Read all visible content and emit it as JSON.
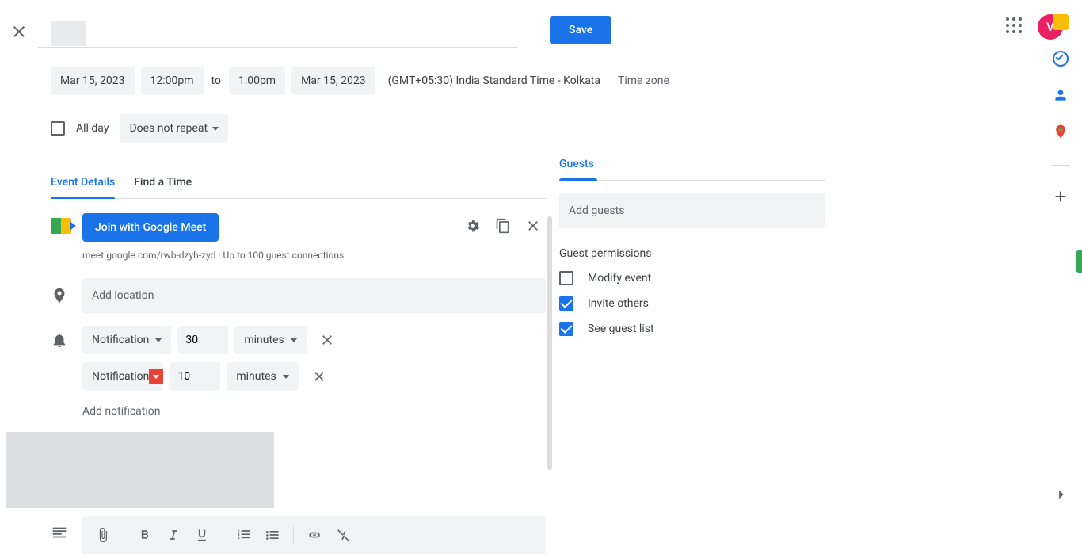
{
  "header": {
    "save_label": "Save",
    "avatar_initial": "V"
  },
  "date": {
    "start_date": "Mar 15, 2023",
    "start_time": "12:00pm",
    "to": "to",
    "end_time": "1:00pm",
    "end_date": "Mar 15, 2023",
    "timezone_text": "(GMT+05:30) India Standard Time - Kolkata",
    "timezone_btn": "Time zone"
  },
  "allday": {
    "label": "All day",
    "repeat": "Does not repeat"
  },
  "tabs": {
    "event_details": "Event Details",
    "find_time": "Find a Time"
  },
  "meet": {
    "btn": "Join with Google Meet",
    "sub": "meet.google.com/rwb-dzyh-zyd · Up to 100 guest connections"
  },
  "location": {
    "placeholder": "Add location"
  },
  "notifications": {
    "type_label": "Notification",
    "unit_label": "minutes",
    "items": [
      {
        "value": "30"
      },
      {
        "value": "10"
      }
    ],
    "add_label": "Add notification"
  },
  "guests": {
    "tab": "Guests",
    "placeholder": "Add guests",
    "perm_title": "Guest permissions",
    "perms": [
      {
        "label": "Modify event",
        "checked": false
      },
      {
        "label": "Invite others",
        "checked": true
      },
      {
        "label": "See guest list",
        "checked": true
      }
    ]
  }
}
